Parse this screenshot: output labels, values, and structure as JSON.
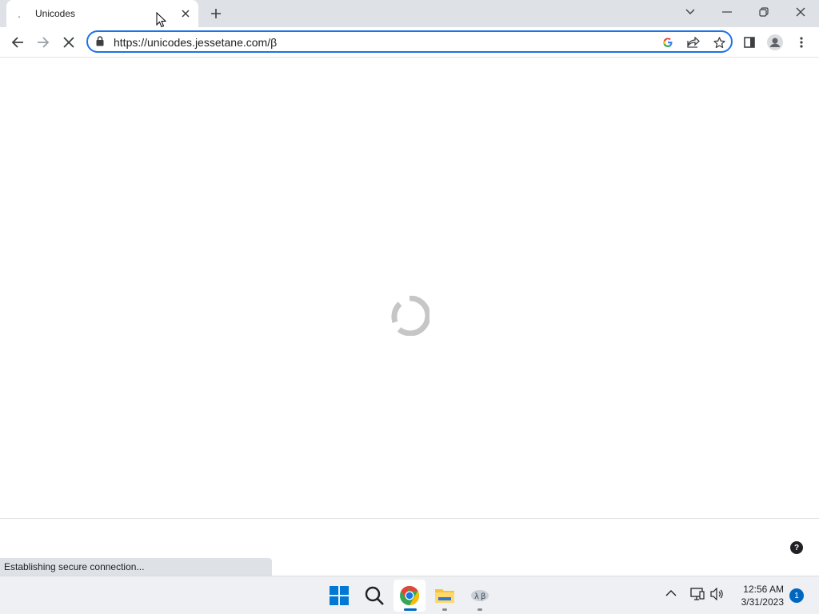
{
  "browser": {
    "tab": {
      "title": "Unicodes",
      "favicon": "."
    },
    "address": {
      "url": "https://unicodes.jessetane.com/β"
    },
    "status_text": "Establishing secure connection..."
  },
  "page": {
    "help_label": "?"
  },
  "taskbar": {
    "clock_time": "12:56 AM",
    "clock_date": "3/31/2023",
    "notification_count": "1",
    "icons": [
      "windows-start-icon",
      "search-icon",
      "chrome-icon",
      "file-explorer-icon",
      "network-app-icon"
    ]
  },
  "colors": {
    "accent": "#1a73e8",
    "tabstrip": "#dee1e6",
    "taskbar": "#eef0f4"
  }
}
